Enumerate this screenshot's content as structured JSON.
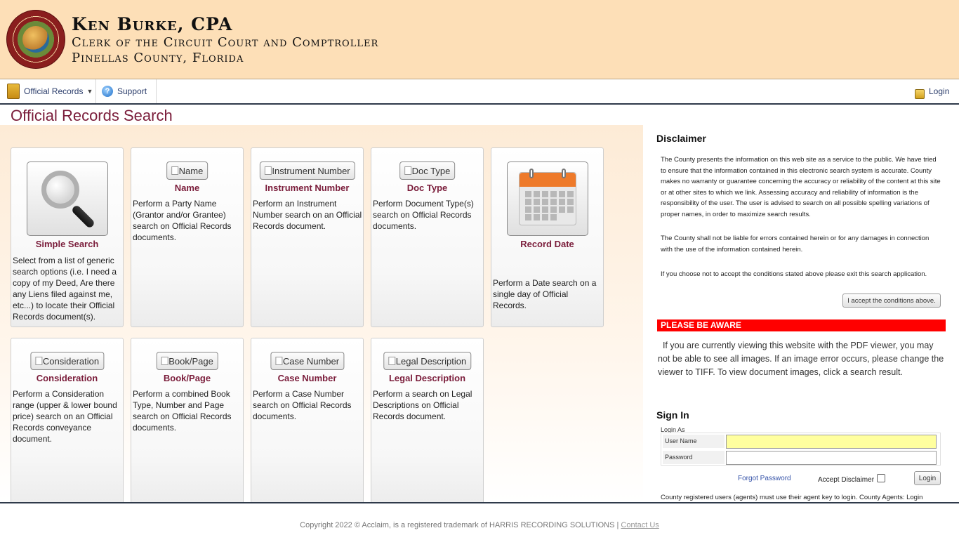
{
  "header": {
    "name": "Ken Burke, CPA",
    "line2": "Clerk of the Circuit Court and Comptroller",
    "line3": "Pinellas County, Florida"
  },
  "nav": {
    "official_records": "Official Records",
    "support": "Support",
    "login": "Login"
  },
  "page_title": "Official Records Search",
  "cards": [
    {
      "label": "Simple Search",
      "desc": "Select from a list of generic search options (i.e. I need a copy of my Deed, Are there any Liens filed against me, etc...) to locate their Official Records document(s)."
    },
    {
      "label": "Name",
      "button": "Name",
      "desc": "Perform a Party Name (Grantor and/or Grantee) search on Official Records documents."
    },
    {
      "label": "Instrument Number",
      "button": "Instrument Number",
      "desc": "Perform an Instrument Number search on an Official Records document."
    },
    {
      "label": "Doc Type",
      "button": "Doc Type",
      "desc": "Perform Document Type(s) search on Official Records documents."
    },
    {
      "label": "Record Date",
      "desc": "Perform a Date search on a single day of Official Records."
    },
    {
      "label": "Consideration",
      "button": "Consideration",
      "desc": "Perform a Consideration range (upper & lower bound price) search on an Official Records conveyance document."
    },
    {
      "label": "Book/Page",
      "button": "Book/Page",
      "desc": "Perform a combined Book Type, Number and Page search on Official Records documents."
    },
    {
      "label": "Case Number",
      "button": "Case Number",
      "desc": "Perform a Case Number search on Official Records documents."
    },
    {
      "label": "Legal Description",
      "button": "Legal Description",
      "desc": "Perform a search on Legal Descriptions on Official Records document."
    }
  ],
  "disclaimer": {
    "title": "Disclaimer",
    "p1": "The County presents the information on this web site as a service to the public. We have tried to ensure that the information contained in this electronic search system is accurate. County makes no warranty or guarantee concerning the accuracy or reliability of the content at this site or at other sites to which we link. Assessing accuracy and reliability of information is the responsibility of the user. The user is advised to search on all possible spelling variations of proper names, in order to maximize search results.",
    "p2": "The County shall not be liable for errors contained herein or for any damages in connection with the use of the information contained herein.",
    "p3": "If you choose not to accept the conditions stated above please exit this search application.",
    "accept_button": "I accept the conditions above."
  },
  "aware": {
    "title": "PLEASE BE AWARE",
    "text": "If you are currently viewing this website with the PDF viewer, you may not be able to see all images. If an image error occurs, please change the viewer to TIFF. To view document images, click a search result."
  },
  "signin": {
    "title": "Sign In",
    "login_as": "Login As",
    "username_label": "User Name",
    "password_label": "Password",
    "username_value": "",
    "password_value": "",
    "forgot": "Forgot Password",
    "accept_disclaimer": "Accept Disclaimer",
    "login_button": "Login",
    "agent_note": "County registered users (agents) must use their agent key to login. County Agents: Login"
  },
  "footer": {
    "text": "Copyright 2022 © Acclaim, is a registered trademark of HARRIS RECORDING SOLUTIONS | ",
    "contact": "Contact Us"
  }
}
